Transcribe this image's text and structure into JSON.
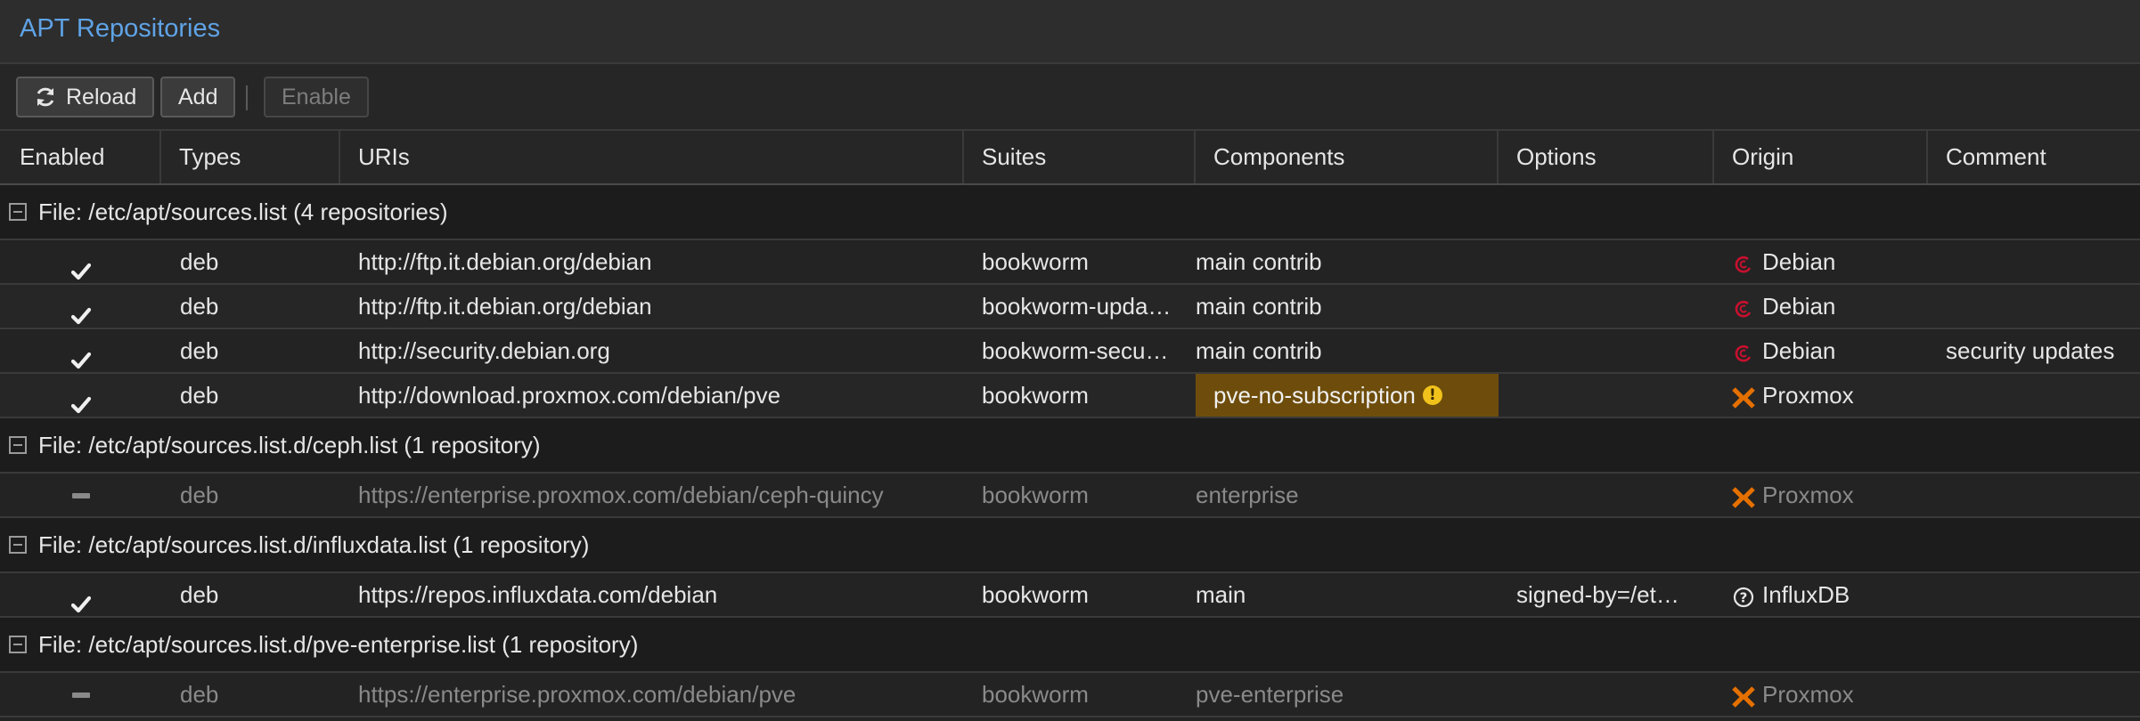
{
  "panel": {
    "title": "APT Repositories"
  },
  "toolbar": {
    "reload_label": "Reload",
    "add_label": "Add",
    "enable_label": "Enable"
  },
  "columns": [
    "Enabled",
    "Types",
    "URIs",
    "Suites",
    "Components",
    "Options",
    "Origin",
    "Comment"
  ],
  "groups": [
    {
      "label": "File: /etc/apt/sources.list (4 repositories)",
      "rows": [
        {
          "enabled": true,
          "type": "deb",
          "uri": "http://ftp.it.debian.org/debian",
          "suites": "bookworm",
          "components": "main contrib",
          "options": "",
          "origin": "Debian",
          "comment": ""
        },
        {
          "enabled": true,
          "type": "deb",
          "uri": "http://ftp.it.debian.org/debian",
          "suites": "bookworm-upda…",
          "components": "main contrib",
          "options": "",
          "origin": "Debian",
          "comment": ""
        },
        {
          "enabled": true,
          "type": "deb",
          "uri": "http://security.debian.org",
          "suites": "bookworm-secu…",
          "components": "main contrib",
          "options": "",
          "origin": "Debian",
          "comment": "security updates"
        },
        {
          "enabled": true,
          "type": "deb",
          "uri": "http://download.proxmox.com/debian/pve",
          "suites": "bookworm",
          "components": "pve-no-subscription",
          "components_warning": true,
          "options": "",
          "origin": "Proxmox",
          "comment": ""
        }
      ]
    },
    {
      "label": "File: /etc/apt/sources.list.d/ceph.list (1 repository)",
      "rows": [
        {
          "enabled": false,
          "type": "deb",
          "uri": "https://enterprise.proxmox.com/debian/ceph-quincy",
          "suites": "bookworm",
          "components": "enterprise",
          "options": "",
          "origin": "Proxmox",
          "comment": ""
        }
      ]
    },
    {
      "label": "File: /etc/apt/sources.list.d/influxdata.list (1 repository)",
      "rows": [
        {
          "enabled": true,
          "type": "deb",
          "uri": "https://repos.influxdata.com/debian",
          "suites": "bookworm",
          "components": "main",
          "options": "signed-by=/et…",
          "origin": "InfluxDB",
          "comment": ""
        }
      ]
    },
    {
      "label": "File: /etc/apt/sources.list.d/pve-enterprise.list (1 repository)",
      "rows": [
        {
          "enabled": false,
          "type": "deb",
          "uri": "https://enterprise.proxmox.com/debian/pve",
          "suites": "bookworm",
          "components": "pve-enterprise",
          "options": "",
          "origin": "Proxmox",
          "comment": ""
        }
      ]
    }
  ],
  "colors": {
    "accent": "#5fa3e6",
    "warning_bg": "#6e4d0c",
    "warning_icon": "#f1c21b",
    "debian_red": "#c8102e",
    "proxmox_orange": "#e57000"
  },
  "icons": {
    "reload": "refresh-icon",
    "enabled": "checkmark-icon",
    "disabled": "dash-icon",
    "group_toggle": "collapse-icon",
    "warning": "exclamation-icon",
    "debian": "debian-swirl-icon",
    "proxmox": "proxmox-x-icon",
    "unknown": "question-circle-icon"
  }
}
